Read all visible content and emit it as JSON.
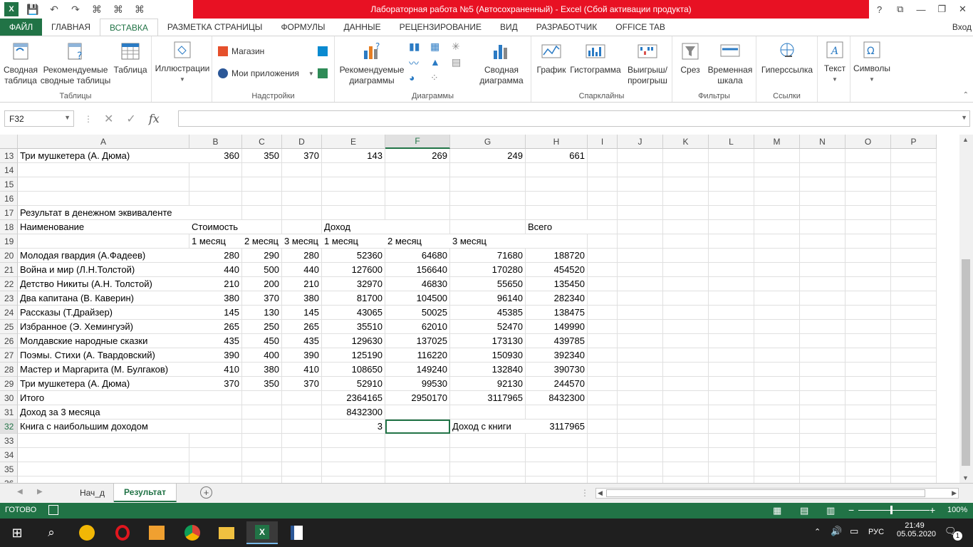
{
  "window": {
    "title": "Лабораторная работа №5 (Автосохраненный) -  Excel (Сбой активации продукта)",
    "help": "?",
    "signin": "Вход"
  },
  "tabs": [
    "ФАЙЛ",
    "ГЛАВНАЯ",
    "ВСТАВКА",
    "РАЗМЕТКА СТРАНИЦЫ",
    "ФОРМУЛЫ",
    "ДАННЫЕ",
    "РЕЦЕНЗИРОВАНИЕ",
    "ВИД",
    "РАЗРАБОТЧИК",
    "OFFICE TAB"
  ],
  "ribbon": {
    "tables": {
      "label": "Таблицы",
      "pivot": "Сводная\nтаблица",
      "recpivot": "Рекомендуемые\nсводные таблицы",
      "table": "Таблица"
    },
    "illus": {
      "label": "Иллюстрации"
    },
    "addins": {
      "label": "Надстройки",
      "store": "Магазин",
      "myapps": "Мои приложения"
    },
    "charts": {
      "label": "Диаграммы",
      "rec": "Рекомендуемые\nдиаграммы",
      "pivotchart": "Сводная\nдиаграмма"
    },
    "spark": {
      "label": "Спарклайны",
      "line": "График",
      "col": "Гистограмма",
      "winloss": "Выигрыш/\nпроигрыш"
    },
    "filters": {
      "label": "Фильтры",
      "slicer": "Срез",
      "timeline": "Временная\nшкала"
    },
    "links": {
      "label": "Ссылки",
      "hyper": "Гиперссылка"
    },
    "text": {
      "label": "Текст"
    },
    "symbols": {
      "label": "Символы"
    }
  },
  "formula": {
    "namebox": "F32",
    "value": ""
  },
  "columns": [
    "A",
    "B",
    "C",
    "D",
    "E",
    "F",
    "G",
    "H",
    "I",
    "J",
    "K",
    "L",
    "M",
    "N",
    "O",
    "P"
  ],
  "rows": [
    {
      "n": "13",
      "c": [
        "Три мушкетера (А. Дюма)",
        "360",
        "350",
        "370",
        "143",
        "269",
        "249",
        "661"
      ]
    },
    {
      "n": "14",
      "c": []
    },
    {
      "n": "15",
      "c": []
    },
    {
      "n": "16",
      "c": []
    },
    {
      "n": "17",
      "c": [
        "Результат в денежном эквиваленте"
      ]
    },
    {
      "n": "18",
      "c": [
        "Наименование",
        "Стоимость",
        "",
        "",
        "Доход",
        "",
        "",
        "Всего"
      ]
    },
    {
      "n": "19",
      "c": [
        "",
        "1 месяц",
        "2 месяц",
        "3 месяц",
        "1 месяц",
        "2 месяц",
        "3 месяц",
        ""
      ]
    },
    {
      "n": "20",
      "c": [
        "Молодая гвардия (А.Фадеев)",
        "280",
        "290",
        "280",
        "52360",
        "64680",
        "71680",
        "188720"
      ]
    },
    {
      "n": "21",
      "c": [
        "Война и мир (Л.Н.Толстой)",
        "440",
        "500",
        "440",
        "127600",
        "156640",
        "170280",
        "454520"
      ]
    },
    {
      "n": "22",
      "c": [
        "Детство Никиты (А.Н. Толстой)",
        "210",
        "200",
        "210",
        "32970",
        "46830",
        "55650",
        "135450"
      ]
    },
    {
      "n": "23",
      "c": [
        "Два капитана (В. Каверин)",
        "380",
        "370",
        "380",
        "81700",
        "104500",
        "96140",
        "282340"
      ]
    },
    {
      "n": "24",
      "c": [
        "Рассказы (Т.Драйзер)",
        "145",
        "130",
        "145",
        "43065",
        "50025",
        "45385",
        "138475"
      ]
    },
    {
      "n": "25",
      "c": [
        "Избранное (Э. Хемингуэй)",
        "265",
        "250",
        "265",
        "35510",
        "62010",
        "52470",
        "149990"
      ]
    },
    {
      "n": "26",
      "c": [
        "Молдавские народные сказки",
        "435",
        "450",
        "435",
        "129630",
        "137025",
        "173130",
        "439785"
      ]
    },
    {
      "n": "27",
      "c": [
        "Поэмы. Стихи (А. Твардовский)",
        "390",
        "400",
        "390",
        "125190",
        "116220",
        "150930",
        "392340"
      ]
    },
    {
      "n": "28",
      "c": [
        "Мастер и Маргарита (М. Булгаков)",
        "410",
        "380",
        "410",
        "108650",
        "149240",
        "132840",
        "390730"
      ]
    },
    {
      "n": "29",
      "c": [
        "Три мушкетера (А. Дюма)",
        "370",
        "350",
        "370",
        "52910",
        "99530",
        "92130",
        "244570"
      ]
    },
    {
      "n": "30",
      "c": [
        "Итого",
        "",
        "",
        "",
        "2364165",
        "2950170",
        "3117965",
        "8432300"
      ]
    },
    {
      "n": "31",
      "c": [
        "Доход за 3 месяца",
        "",
        "",
        "",
        "8432300",
        "",
        "",
        ""
      ]
    },
    {
      "n": "32",
      "c": [
        "Книга с наибольшим доходом",
        "",
        "",
        "",
        "3",
        "",
        "Доход с книги",
        "3117965"
      ]
    },
    {
      "n": "33",
      "c": []
    },
    {
      "n": "34",
      "c": []
    },
    {
      "n": "35",
      "c": []
    },
    {
      "n": "36",
      "c": []
    }
  ],
  "sheets": [
    "Нач_д",
    "Результат"
  ],
  "status": {
    "ready": "ГОТОВО",
    "zoom": "100%"
  },
  "taskbar": {
    "lang": "РУС",
    "time": "21:49",
    "date": "05.05.2020",
    "notif": "1"
  }
}
